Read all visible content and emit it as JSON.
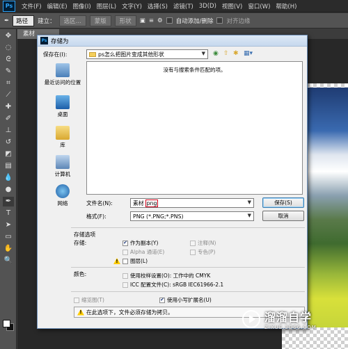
{
  "menubar": {
    "logo": "Ps",
    "items": [
      "文件(F)",
      "编辑(E)",
      "图像(I)",
      "图层(L)",
      "文字(Y)",
      "选择(S)",
      "滤镜(T)",
      "3D(D)",
      "视图(V)",
      "窗口(W)",
      "帮助(H)"
    ]
  },
  "options": {
    "path_mode": "路径",
    "create_label": "建立：",
    "selection_btn": "选区...",
    "mask_btn": "蒙版",
    "shape_btn": "形状",
    "auto_add_delete": "自动添加/删除",
    "align_edges": "对齐边缘"
  },
  "document": {
    "tab": "素材"
  },
  "dialog": {
    "title": "存储为",
    "save_in_label": "保存在(I):",
    "save_in_value": "ps怎么把图片变成其他形状",
    "empty_message": "没有与搜索条件匹配的项。",
    "places": [
      "最近访问的位置",
      "桌面",
      "库",
      "计算机",
      "网络"
    ],
    "filename_label": "文件名(N):",
    "filename_base": "素材",
    "filename_ext": "png",
    "format_label": "格式(F):",
    "format_value": "PNG (*.PNG;*.PNS)",
    "save_button": "保存(S)",
    "cancel_button": "取消",
    "save_options_title": "存储选项",
    "storage_label": "存储:",
    "as_copy": "作为副本(Y)",
    "notes": "注释(N)",
    "alpha_channels": "Alpha 通道(E)",
    "spot_colors": "专色(P)",
    "layers": "图层(L)",
    "color_label": "颜色:",
    "use_proof_setup": "使用校样设置(O): 工作中的 CMYK",
    "icc_profile": "ICC 配置文件(C): sRGB IEC61966-2.1",
    "thumbnail": "缩览图(T)",
    "lowercase_ext": "使用小写扩展名(U)",
    "info_message": "在此选项下，文件必须存储为拷贝。"
  },
  "watermark": {
    "title": "溜溜自学",
    "subtitle": "ZIXUE.3D66.COM"
  },
  "colors": {
    "accent_red": "#d0021b",
    "dialog_border": "#6d8fb8"
  }
}
